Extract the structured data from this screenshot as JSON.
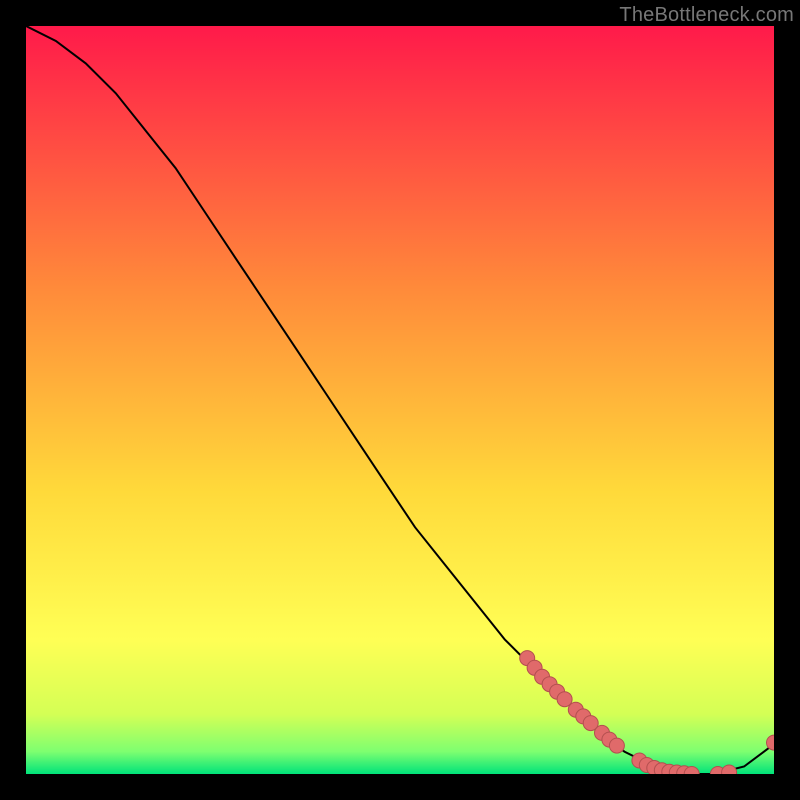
{
  "watermark": "TheBottleneck.com",
  "colors": {
    "gradient_top": "#ff1a4a",
    "gradient_mid1": "#ff6a3a",
    "gradient_mid2": "#ffd93a",
    "gradient_mid3": "#ffff55",
    "gradient_bottom": "#00e37a",
    "curve": "#000000",
    "dot_fill": "#e06a6a",
    "dot_stroke": "#b34f4f"
  },
  "chart_data": {
    "type": "line",
    "title": "",
    "xlabel": "",
    "ylabel": "",
    "xlim": [
      0,
      100
    ],
    "ylim": [
      0,
      100
    ],
    "grid": false,
    "legend": false,
    "series": [
      {
        "name": "curve",
        "x": [
          0,
          4,
          8,
          12,
          16,
          20,
          24,
          28,
          32,
          36,
          40,
          44,
          48,
          52,
          56,
          60,
          64,
          68,
          72,
          76,
          80,
          84,
          88,
          92,
          96,
          100
        ],
        "y": [
          100,
          98,
          95,
          91,
          86,
          81,
          75,
          69,
          63,
          57,
          51,
          45,
          39,
          33,
          28,
          23,
          18,
          14,
          10,
          6,
          3,
          1,
          0,
          0,
          1,
          4
        ]
      }
    ],
    "dots": [
      {
        "x": 67.0,
        "y": 15.5
      },
      {
        "x": 68.0,
        "y": 14.2
      },
      {
        "x": 69.0,
        "y": 13.0
      },
      {
        "x": 70.0,
        "y": 12.0
      },
      {
        "x": 71.0,
        "y": 11.0
      },
      {
        "x": 72.0,
        "y": 10.0
      },
      {
        "x": 73.5,
        "y": 8.6
      },
      {
        "x": 74.5,
        "y": 7.7
      },
      {
        "x": 75.5,
        "y": 6.8
      },
      {
        "x": 77.0,
        "y": 5.5
      },
      {
        "x": 78.0,
        "y": 4.6
      },
      {
        "x": 79.0,
        "y": 3.8
      },
      {
        "x": 82.0,
        "y": 1.8
      },
      {
        "x": 83.0,
        "y": 1.2
      },
      {
        "x": 84.0,
        "y": 0.8
      },
      {
        "x": 85.0,
        "y": 0.5
      },
      {
        "x": 86.0,
        "y": 0.3
      },
      {
        "x": 87.0,
        "y": 0.2
      },
      {
        "x": 88.0,
        "y": 0.1
      },
      {
        "x": 89.0,
        "y": 0.0
      },
      {
        "x": 92.5,
        "y": 0.0
      },
      {
        "x": 94.0,
        "y": 0.2
      },
      {
        "x": 100.0,
        "y": 4.2
      }
    ]
  }
}
